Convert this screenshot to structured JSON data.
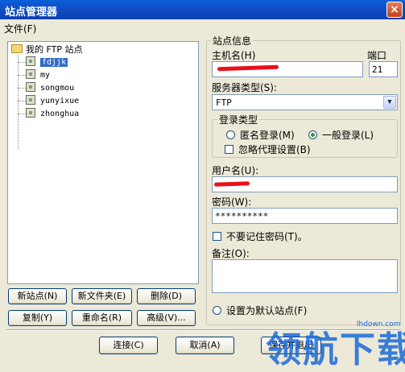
{
  "window": {
    "title": "站点管理器",
    "close_label": "×"
  },
  "menu": {
    "file": "文件(F)"
  },
  "tree": {
    "root": "我的 FTP 站点",
    "sites": [
      "fdjjk",
      "my",
      "songmou",
      "yunyixue",
      "zhonghua"
    ],
    "selected": "fdjjk"
  },
  "left_buttons": {
    "new_site": "新站点(N)",
    "new_folder": "新文件夹(E)",
    "delete": "删除(D)",
    "copy": "复制(Y)",
    "rename": "重命名(R)",
    "advanced": "高级(V)..."
  },
  "site_info": {
    "group_title": "站点信息",
    "host_label": "主机名(H)",
    "host_value": "",
    "port_label": "端口",
    "port_value": "21",
    "server_type_label": "服务器类型(S):",
    "server_type_value": "FTP",
    "login_group_title": "登录类型",
    "anonymous_label": "匿名登录(M)",
    "normal_label": "一般登录(L)",
    "ignore_proxy_label": "忽略代理设置(B)",
    "username_label": "用户名(U):",
    "username_value": "",
    "password_label": "密码(W):",
    "password_value": "**********",
    "dont_remember_label": "不要记住密码(T)。",
    "notes_label": "备注(O):",
    "default_site_label": "设置为默认站点(F)"
  },
  "bottom_buttons": {
    "connect": "连接(C)",
    "cancel": "取消(A)",
    "save_exit": "保存并退出"
  },
  "watermark": {
    "text": "领航下载",
    "url": "lhdown.com"
  }
}
